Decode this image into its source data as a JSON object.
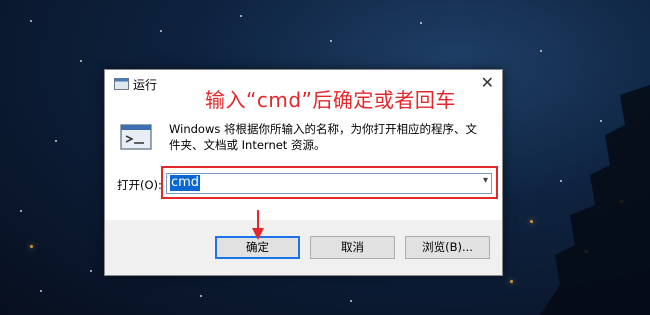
{
  "dialog": {
    "title": "运行",
    "annotation": "输入“cmd”后确定或者回车",
    "description": "Windows 将根据你所输入的名称，为你打开相应的程序、文件夹、文档或 Internet 资源。",
    "open_label": "打开(O):",
    "input_value": "cmd",
    "buttons": {
      "ok": "确定",
      "cancel": "取消",
      "browse": "浏览(B)..."
    }
  },
  "colors": {
    "annotation_red": "#e3282c",
    "selection_blue": "#0a66d0",
    "ok_border": "#1a73e8"
  }
}
